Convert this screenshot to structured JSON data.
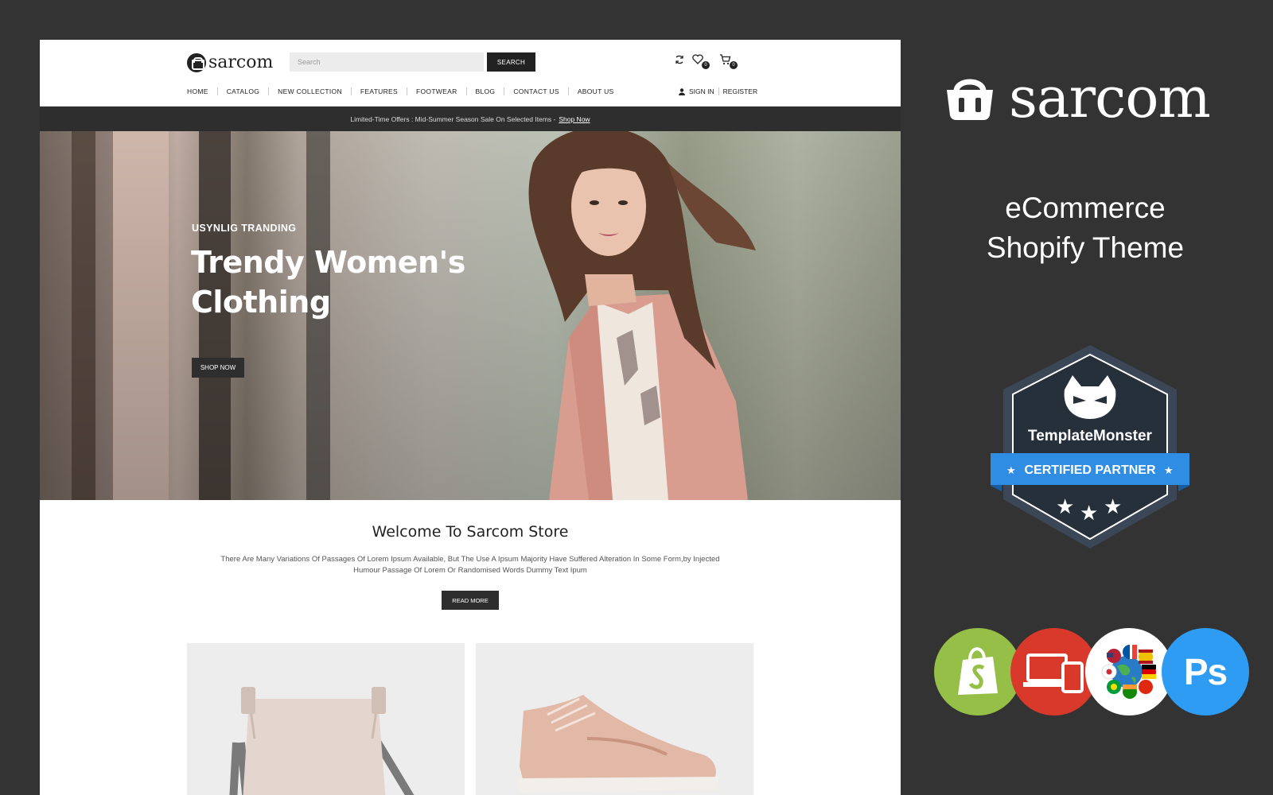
{
  "site": {
    "logo_text": "sarcom",
    "search_placeholder": "Search",
    "search_button": "SEARCH",
    "wishlist_count": "0",
    "cart_count": "0",
    "nav": [
      "HOME",
      "CATALOG",
      "NEW COLLECTION",
      "FEATURES",
      "FOOTWEAR",
      "BLOG",
      "CONTACT US",
      "ABOUT US"
    ],
    "sign_in": "SIGN IN",
    "register": "REGISTER",
    "promo_text": "Limited-Time Offers : Mid-Summer Season Sale On Selected Items -",
    "promo_link": "Shop Now",
    "hero": {
      "eyebrow": "USYNLIG TRANDING",
      "title": "Trendy Women's Clothing",
      "button": "SHOP NOW"
    },
    "welcome": {
      "title": "Welcome To Sarcom Store",
      "text": "There Are Many Variations Of Passages Of Lorem Ipsum Available, But The Use A Ipsum Majority Have Suffered Alteration In Some Form,by Injected Humour Passage Of Lorem Or Randomised Words Dummy Text Ipum",
      "button": "READ MORE"
    }
  },
  "panel": {
    "brand": "sarcom",
    "tagline_line1": "eCommerce",
    "tagline_line2": "Shopify Theme",
    "badge_name": "TemplateMonster",
    "badge_label": "CERTIFIED PARTNER",
    "ps_label": "Ps"
  },
  "colors": {
    "background": "#333333",
    "dark": "#2e2e2e",
    "badge_blue": "#2f8de4",
    "shopify_green": "#95bf47",
    "responsive_red": "#d8392b",
    "photoshop_blue": "#2d9cf2"
  }
}
